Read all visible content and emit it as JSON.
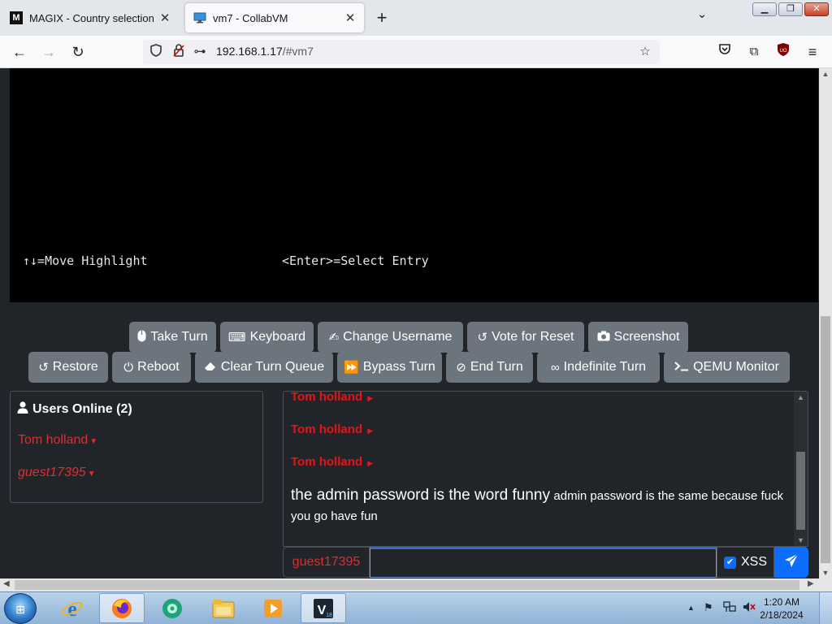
{
  "browser": {
    "tabs": [
      {
        "favicon": "M",
        "title": "MAGIX - Country selection",
        "active": false
      },
      {
        "favicon": "monitor-icon",
        "title": "vm7 - CollabVM",
        "active": true
      }
    ],
    "url_host": "192.168.1.17",
    "url_path": "/#vm7"
  },
  "vm": {
    "line_left": "↑↓=Move Highlight",
    "line_right": "<Enter>=Select Entry"
  },
  "toolbar": {
    "row1": [
      {
        "icon": "mouse-icon",
        "label": "Take Turn"
      },
      {
        "icon": "keyboard-icon",
        "label": "Keyboard"
      },
      {
        "icon": "user-pen-icon",
        "label": "Change Username"
      },
      {
        "icon": "rotate-icon",
        "label": "Vote for Reset"
      },
      {
        "icon": "camera-icon",
        "label": "Screenshot"
      }
    ],
    "row2": [
      {
        "icon": "restore-icon",
        "label": "Restore"
      },
      {
        "icon": "power-icon",
        "label": "Reboot"
      },
      {
        "icon": "eraser-icon",
        "label": "Clear Turn Queue"
      },
      {
        "icon": "forward-icon",
        "label": "Bypass Turn"
      },
      {
        "icon": "ban-icon",
        "label": "End Turn"
      },
      {
        "icon": "infinity-icon",
        "label": "Indefinite Turn"
      },
      {
        "icon": "terminal-icon",
        "label": "QEMU Monitor"
      }
    ]
  },
  "users": {
    "title": "Users Online (2)",
    "list": [
      "Tom holland",
      "guest17395"
    ]
  },
  "chat": {
    "names": [
      "Tom holland",
      "Tom holland",
      "Tom holland"
    ],
    "message_big": "the admin password is the word funny",
    "message_small": "admin password is the same because fuck you go have fun"
  },
  "input": {
    "username": "guest17395",
    "message_value": "",
    "xss_label": "XSS",
    "xss_checked": true
  },
  "taskbar": {
    "time": "1:20 AM",
    "date": "2/18/2024",
    "pinned": [
      "internet-explorer-icon",
      "firefox-icon",
      "media-icon",
      "explorer-folder-icon",
      "media-player-icon",
      "vegas-icon"
    ]
  },
  "colors": {
    "page_bg": "#212529",
    "button_bg": "#6c757d",
    "username_red": "#dc2f2f",
    "send_blue": "#0d6efd"
  }
}
